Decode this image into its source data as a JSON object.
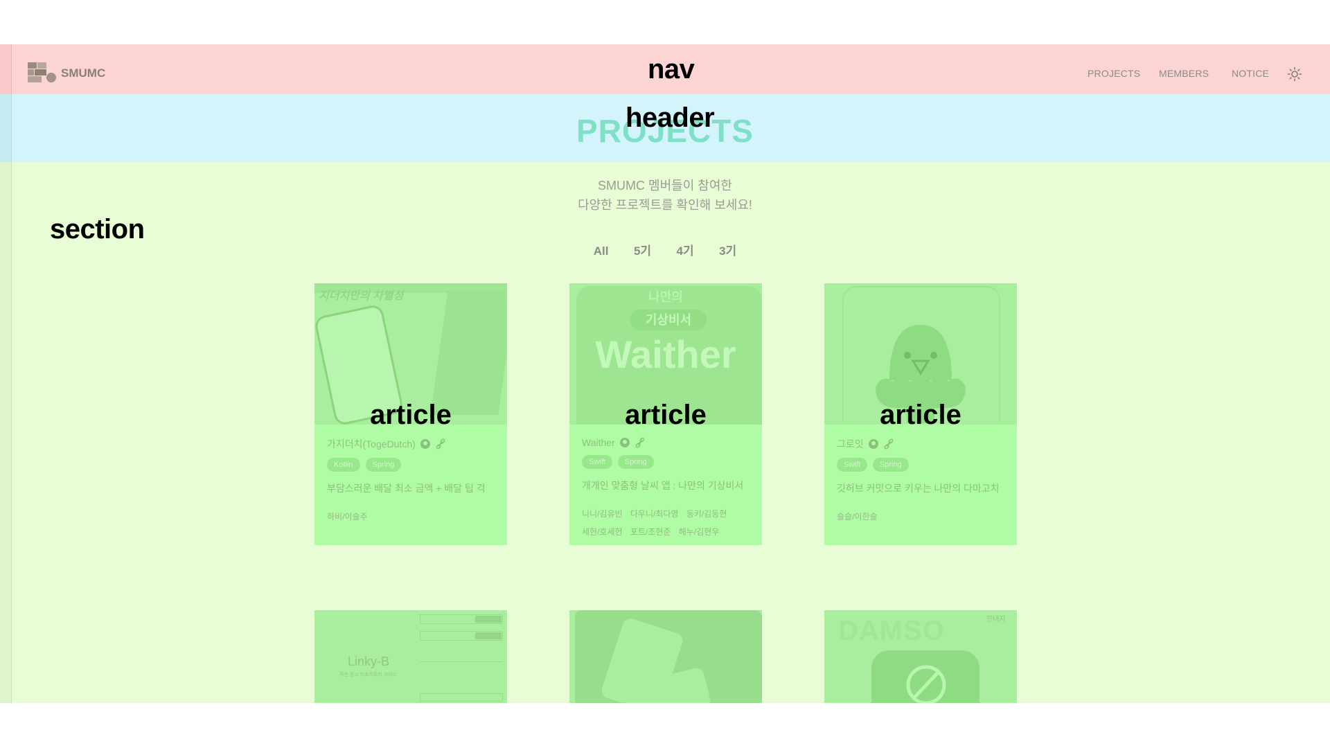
{
  "overlay_labels": {
    "nav": "nav",
    "header": "header",
    "section": "section",
    "article": "article"
  },
  "nav": {
    "brand": "SMUMC",
    "links": [
      "PROJECTS",
      "MEMBERS",
      "NOTICE"
    ],
    "theme_icon": "sun-icon"
  },
  "header": {
    "title": "PROJECTS"
  },
  "section": {
    "subtitle_line1": "SMUMC 멤버들이 참여한",
    "subtitle_line2": "다양한 프로젝트를 확인해 보세요!",
    "filters": [
      "All",
      "5기",
      "4기",
      "3기"
    ]
  },
  "cards": [
    {
      "image_text": "지더치만의 차별성",
      "title": "가지더치(TogeDutch)",
      "tags": [
        "Kotlin",
        "Spring"
      ],
      "desc": "부담스러운 배달 최소 금액 + 배달 팁 걱",
      "members": [
        "하비/이슬주"
      ]
    },
    {
      "image_text_top": "나만의",
      "image_text_mid": "기상비서",
      "image_text_big": "Waither",
      "title": "Waither",
      "tags": [
        "Swift",
        "Spring"
      ],
      "desc": "개개인 맞춤형 날씨 앱 : 나만의 기상비서",
      "members": [
        "니니/김유빈",
        "다우니/최다영",
        "동키/김동현",
        "세헌/호세헌",
        "포트/조현준",
        "해누/김현우"
      ]
    },
    {
      "title": "그로잇",
      "tags": [
        "Swift",
        "Spring"
      ],
      "desc": "깃허브 커밋으로 키우는 나만의 다마고치",
      "members": [
        "슬슬/이한슬"
      ]
    },
    {
      "image_text": "Linky-B",
      "image_sub": "작은 링크 리포지토리 서비스"
    },
    {
      "image_text": ""
    },
    {
      "image_text": "DAMSO",
      "image_sub": "안내자"
    }
  ]
}
